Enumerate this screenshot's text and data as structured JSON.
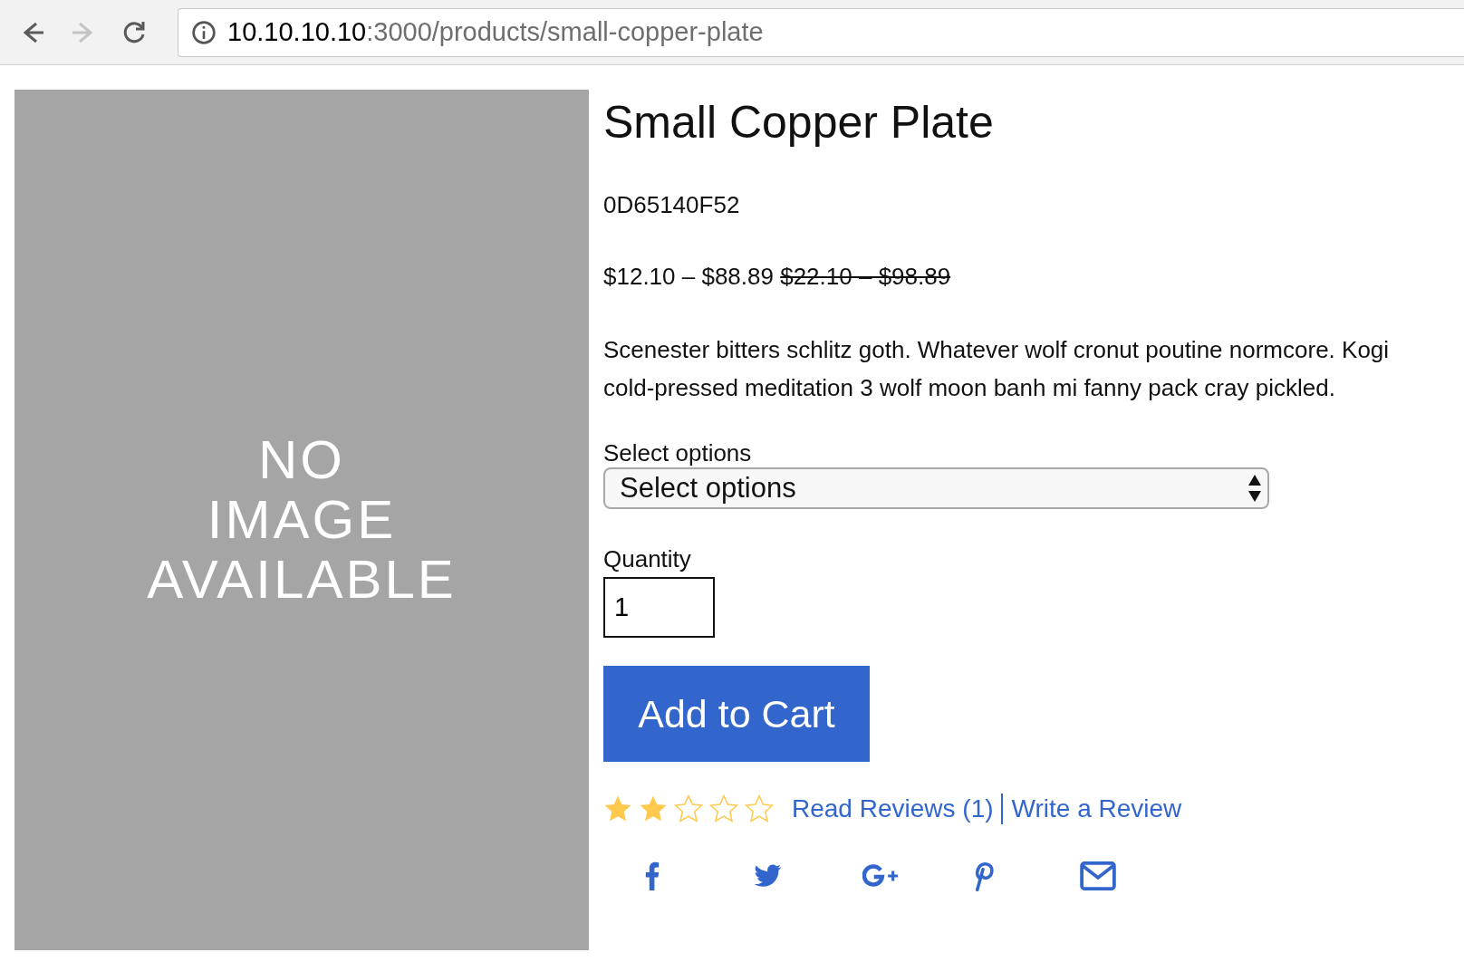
{
  "browser": {
    "nav": [
      {
        "kind": "back",
        "disabled": false
      },
      {
        "kind": "forward",
        "disabled": true
      },
      {
        "kind": "reload",
        "disabled": false
      }
    ],
    "address": {
      "host": "10.10.10.10",
      "rest": ":3000/products/small-copper-plate"
    }
  },
  "image_placeholder": {
    "lines": [
      "NO",
      "IMAGE",
      "AVAILABLE"
    ]
  },
  "product": {
    "title": "Small Copper Plate",
    "sku": "0D65140F52",
    "price": "$12.10 – $88.89",
    "original_price": "$22.10 – $98.89",
    "description": "Scenester bitters schlitz goth. Whatever wolf cronut poutine normcore. Kogi cold-pressed meditation 3 wolf moon banh mi fanny pack cray pickled.",
    "options": {
      "label": "Select options",
      "value": "Select options"
    },
    "quantity": {
      "label": "Quantity",
      "value": "1"
    },
    "add_button": "Add to Cart",
    "rating": {
      "stars": 2,
      "read_reviews": "Read Reviews (1)",
      "write_review": "Write a Review"
    },
    "share": [
      {
        "kind": "facebook"
      },
      {
        "kind": "twitter"
      },
      {
        "kind": "google-plus"
      },
      {
        "kind": "pinterest"
      },
      {
        "kind": "email"
      }
    ]
  }
}
